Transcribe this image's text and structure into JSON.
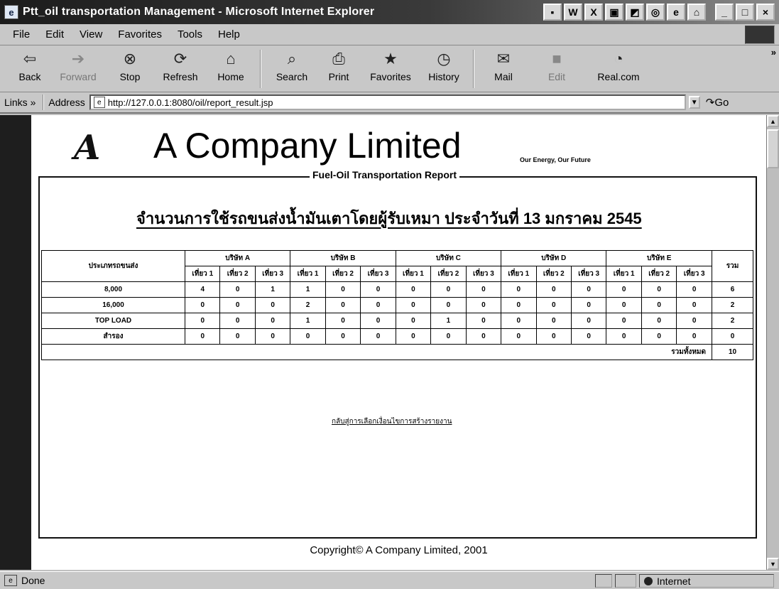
{
  "window": {
    "title": "Ptt_oil transportation Management - Microsoft Internet Explorer"
  },
  "menu": [
    "File",
    "Edit",
    "View",
    "Favorites",
    "Tools",
    "Help"
  ],
  "toolbar": {
    "back": "Back",
    "forward": "Forward",
    "stop": "Stop",
    "refresh": "Refresh",
    "home": "Home",
    "search": "Search",
    "print": "Print",
    "favorites": "Favorites",
    "history": "History",
    "mail": "Mail",
    "edit": "Edit",
    "realcom": "Real.com"
  },
  "addressbar": {
    "links_label": "Links",
    "address_label": "Address",
    "url": "http://127.0.0.1:8080/oil/report_result.jsp",
    "go_label": "Go"
  },
  "page": {
    "logo_letter": "A",
    "company_name": "A Company Limited",
    "tagline": "Our Energy, Our Future",
    "report_legend": "Fuel-Oil Transportation Report",
    "thai_title": "จำนวนการใช้รถขนส่งน้ำมันเตาโดยผู้รับเหมา ประจำวันที่ 13 มกราคม 2545",
    "back_link": "กลับสู่การเลือกเงื่อนไขการสร้างรายงาน",
    "copyright": "Copyright© A Company Limited, 2001"
  },
  "table": {
    "type_header": "ประเภทรถขนส่ง",
    "total_header": "รวม",
    "companies": [
      "บริษัท A",
      "บริษัท B",
      "บริษัท C",
      "บริษัท D",
      "บริษัท E"
    ],
    "trips": [
      "เที่ยว 1",
      "เที่ยว 2",
      "เที่ยว 3"
    ],
    "rows": [
      {
        "type": "8,000",
        "values": [
          "4",
          "0",
          "1",
          "1",
          "0",
          "0",
          "0",
          "0",
          "0",
          "0",
          "0",
          "0",
          "0",
          "0",
          "0"
        ],
        "total": "6"
      },
      {
        "type": "16,000",
        "values": [
          "0",
          "0",
          "0",
          "2",
          "0",
          "0",
          "0",
          "0",
          "0",
          "0",
          "0",
          "0",
          "0",
          "0",
          "0"
        ],
        "total": "2"
      },
      {
        "type": "TOP LOAD",
        "values": [
          "0",
          "0",
          "0",
          "1",
          "0",
          "0",
          "0",
          "1",
          "0",
          "0",
          "0",
          "0",
          "0",
          "0",
          "0"
        ],
        "total": "2"
      },
      {
        "type": "สำรอง",
        "values": [
          "0",
          "0",
          "0",
          "0",
          "0",
          "0",
          "0",
          "0",
          "0",
          "0",
          "0",
          "0",
          "0",
          "0",
          "0"
        ],
        "total": "0"
      }
    ],
    "grand_total_label": "รวมทั้งหมด",
    "grand_total": "10"
  },
  "status": {
    "text": "Done",
    "zone": "Internet"
  }
}
